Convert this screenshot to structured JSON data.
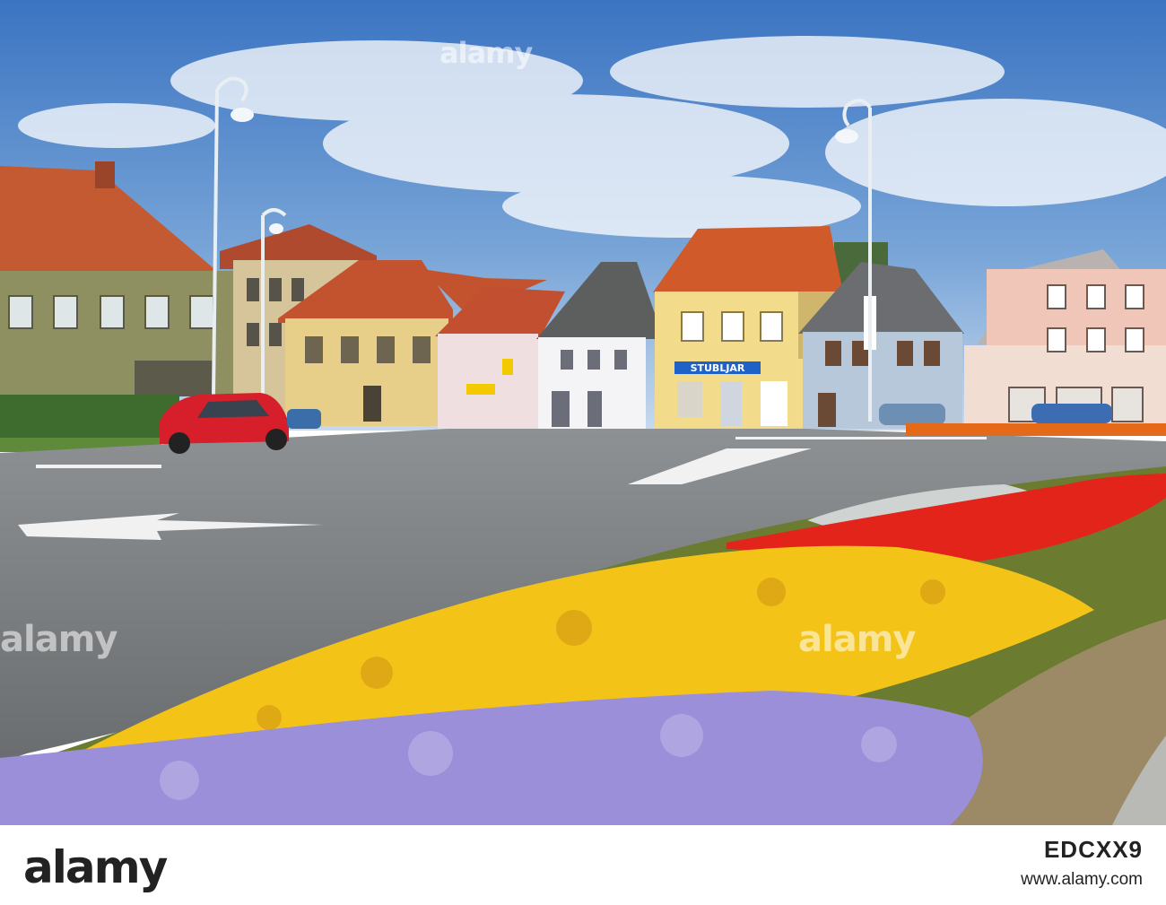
{
  "scene": {
    "colors": {
      "sky": "#4f86c8",
      "road": "#7b7e80",
      "roof": "#c9552f",
      "car": "#d61f2a",
      "marigold": "#f3c417",
      "salvia": "#e3241b",
      "ageratum": "#9a8fd8"
    },
    "signs": {
      "shop_sign": "STUBLJAR"
    }
  },
  "watermark": {
    "brand": "alamy"
  },
  "footer": {
    "logo": "alamy",
    "image_id": "EDCXX9",
    "site": "www.alamy.com"
  }
}
